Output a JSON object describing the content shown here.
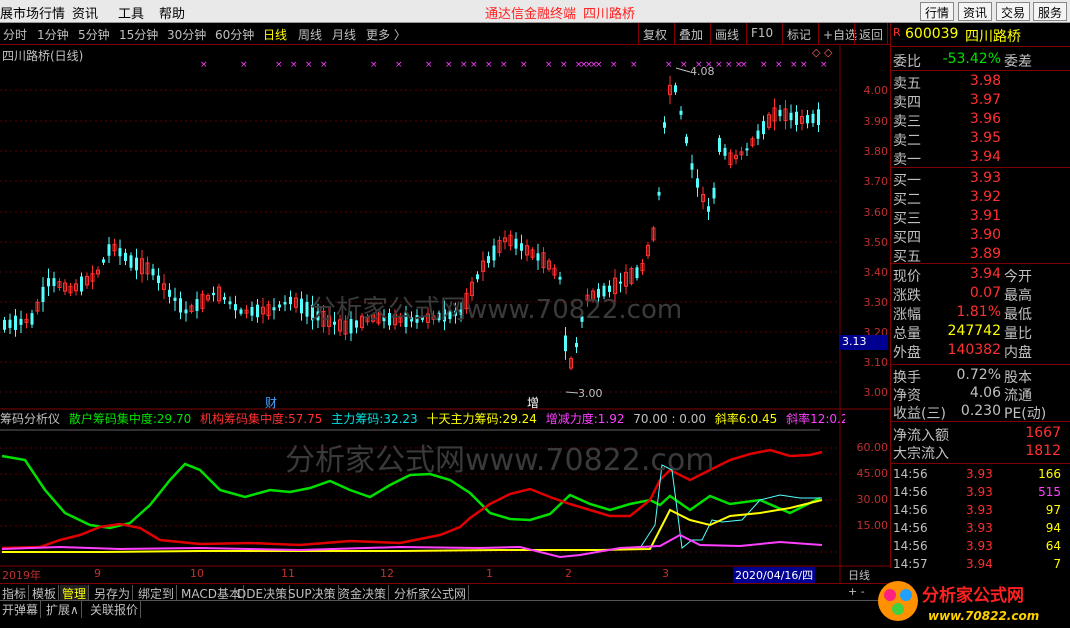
{
  "menubar": {
    "items": [
      "展市场行情",
      "资讯",
      "工具",
      "帮助"
    ],
    "title": "通达信金融终端",
    "title_stock": "四川路桥",
    "right_buttons": [
      "行情",
      "资讯",
      "交易",
      "服务"
    ]
  },
  "toolbar": {
    "periods": [
      "分时",
      "1分钟",
      "5分钟",
      "15分钟",
      "30分钟",
      "60分钟",
      "日线",
      "周线",
      "月线",
      "更多 〉"
    ],
    "selected_period": "日线",
    "buttons": [
      "复权",
      "叠加",
      "画线",
      "F10",
      "标记",
      "+自选",
      "返回"
    ]
  },
  "chart": {
    "title": "四川路桥(日线)",
    "y_labels": [
      "4.00",
      "3.90",
      "3.80",
      "3.70",
      "3.60",
      "3.50",
      "3.40",
      "3.30",
      "3.20",
      "3.10",
      "3.00"
    ],
    "current_price_tag": "3.13",
    "high_label": "4.08",
    "low_label": "3.00",
    "event_labels": [
      "财",
      "增"
    ],
    "watermark": "分析家公式网www.70822.com"
  },
  "indicator": {
    "name": "筹码分析仪",
    "items": [
      {
        "label": "散户筹码集中度:",
        "value": "29.70",
        "color": "#00e000"
      },
      {
        "label": "机构筹码集中度:",
        "value": "57.75",
        "color": "#ff3030"
      },
      {
        "label": "主力筹码:",
        "value": "32.23",
        "color": "#00e0e0"
      },
      {
        "label": "十天主力筹码:",
        "value": "29.24",
        "color": "#ffff00"
      },
      {
        "label": "增减力度:",
        "value": "1.92",
        "color": "#ff40ff"
      },
      {
        "label": "",
        "value": "70.00 : 0.00",
        "color": "#c0c0c0"
      },
      {
        "label": "斜率6:",
        "value": "0.45",
        "color": "#ffff00"
      },
      {
        "label": "斜率12:",
        "value": "0.29",
        "color": "#ff40ff"
      },
      {
        "label": "斜率",
        "value": "",
        "color": "#00e000"
      }
    ],
    "y_labels": [
      "60.00",
      "45.00",
      "30.00",
      "15.00"
    ]
  },
  "x_axis": {
    "labels": [
      "2019年",
      "9",
      "10",
      "11",
      "12",
      "1",
      "2",
      "3"
    ],
    "cursor_date": "2020/04/16/四",
    "right_label": "日线"
  },
  "tabs": [
    "指标",
    "模板",
    "管理",
    "另存为",
    "绑定到",
    "MACD基本",
    "DDE决策",
    "SUP决策",
    "资金决策",
    "分析家公式网"
  ],
  "active_tab": "管理",
  "bottom_tabs": [
    "开弹幕",
    "扩展∧",
    "关联报价"
  ],
  "side": {
    "code": "600039",
    "name": "四川路桥",
    "weibi_label": "委比",
    "weibi_value": "-53.42%",
    "weicha_label": "委差",
    "asks": [
      {
        "label": "卖五",
        "price": "3.98"
      },
      {
        "label": "卖四",
        "price": "3.97"
      },
      {
        "label": "卖三",
        "price": "3.96"
      },
      {
        "label": "卖二",
        "price": "3.95"
      },
      {
        "label": "卖一",
        "price": "3.94"
      }
    ],
    "bids": [
      {
        "label": "买一",
        "price": "3.93"
      },
      {
        "label": "买二",
        "price": "3.92"
      },
      {
        "label": "买三",
        "price": "3.91"
      },
      {
        "label": "买四",
        "price": "3.90"
      },
      {
        "label": "买五",
        "price": "3.89"
      }
    ],
    "quote": [
      {
        "l": "现价",
        "v": "3.94",
        "r": "今开",
        "c": "#ff3030"
      },
      {
        "l": "涨跌",
        "v": "0.07",
        "r": "最高",
        "c": "#ff3030"
      },
      {
        "l": "涨幅",
        "v": "1.81%",
        "r": "最低",
        "c": "#ff3030"
      },
      {
        "l": "总量",
        "v": "247742",
        "r": "量比",
        "c": "#ffff00"
      },
      {
        "l": "外盘",
        "v": "140382",
        "r": "内盘",
        "c": "#ff3030"
      }
    ],
    "quote2": [
      {
        "l": "换手",
        "v": "0.72%",
        "r": "股本",
        "c": "#c0c0c0"
      },
      {
        "l": "净资",
        "v": "4.06",
        "r": "流通",
        "c": "#c0c0c0"
      },
      {
        "l": "收益(三)",
        "v": "0.230",
        "r": "PE(动)",
        "c": "#c0c0c0"
      }
    ],
    "flows": [
      {
        "l": "净流入额",
        "v": "1667"
      },
      {
        "l": "大宗流入",
        "v": "1812"
      }
    ],
    "ticks": [
      {
        "t": "14:56",
        "p": "3.93",
        "v": "166",
        "c": "#ffff00"
      },
      {
        "t": "14:56",
        "p": "3.93",
        "v": "515",
        "c": "#ff40ff"
      },
      {
        "t": "14:56",
        "p": "3.93",
        "v": "97",
        "c": "#ffff00"
      },
      {
        "t": "14:56",
        "p": "3.93",
        "v": "94",
        "c": "#ffff00"
      },
      {
        "t": "14:56",
        "p": "3.93",
        "v": "64",
        "c": "#ffff00"
      },
      {
        "t": "14:57",
        "p": "3.94",
        "v": "7",
        "c": "#ffff00"
      }
    ]
  },
  "logo": {
    "text": "分析家公式网",
    "url": "www.70822.com"
  }
}
